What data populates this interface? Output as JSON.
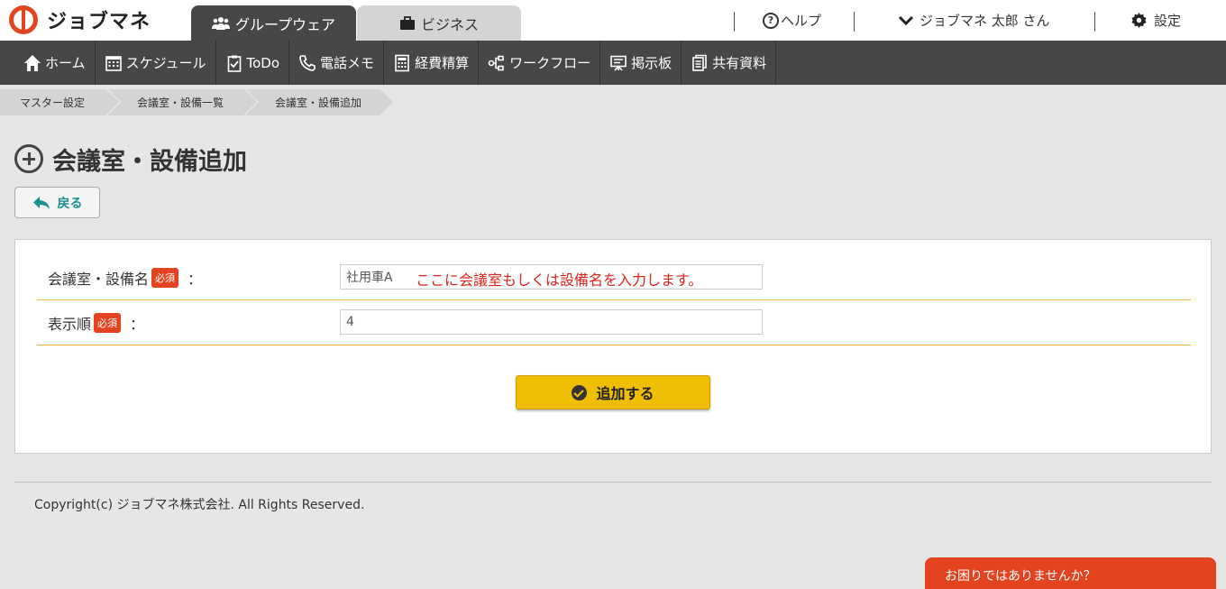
{
  "brand": {
    "name": "ジョブマネ"
  },
  "tabs": [
    {
      "label": "グループウェア",
      "active": true
    },
    {
      "label": "ビジネス",
      "active": false
    }
  ],
  "top_right": {
    "help": "ヘルプ",
    "user": "ジョブマネ 太郎 さん",
    "settings": "設定"
  },
  "nav": [
    {
      "label": "ホーム",
      "icon": "home-icon"
    },
    {
      "label": "スケジュール",
      "icon": "calendar-icon"
    },
    {
      "label": "ToDo",
      "icon": "clipboard-check-icon"
    },
    {
      "label": "電話メモ",
      "icon": "phone-icon"
    },
    {
      "label": "経費精算",
      "icon": "calculator-icon"
    },
    {
      "label": "ワークフロー",
      "icon": "workflow-icon"
    },
    {
      "label": "掲示板",
      "icon": "board-icon"
    },
    {
      "label": "共有資料",
      "icon": "documents-icon"
    }
  ],
  "breadcrumb": [
    "マスター設定",
    "会議室・設備一覧",
    "会議室・設備追加"
  ],
  "page": {
    "title": "会議室・設備追加",
    "back_label": "戻る"
  },
  "form": {
    "required_badge": "必須",
    "colon": "：",
    "name_label": "会議室・設備名",
    "name_value": "社用車A",
    "name_hint": "ここに会議室もしくは設備名を入力します。",
    "order_label": "表示順",
    "order_value": "4",
    "submit_label": "追加する"
  },
  "footer": {
    "copyright": "Copyright(c) ジョブマネ株式会社. All Rights Reserved."
  },
  "help_chat": {
    "label": "お困りではありませんか？"
  },
  "colors": {
    "accent": "#e4431f",
    "nav_bg": "#474747",
    "button": "#f0be00",
    "teal": "#1a8f92"
  }
}
